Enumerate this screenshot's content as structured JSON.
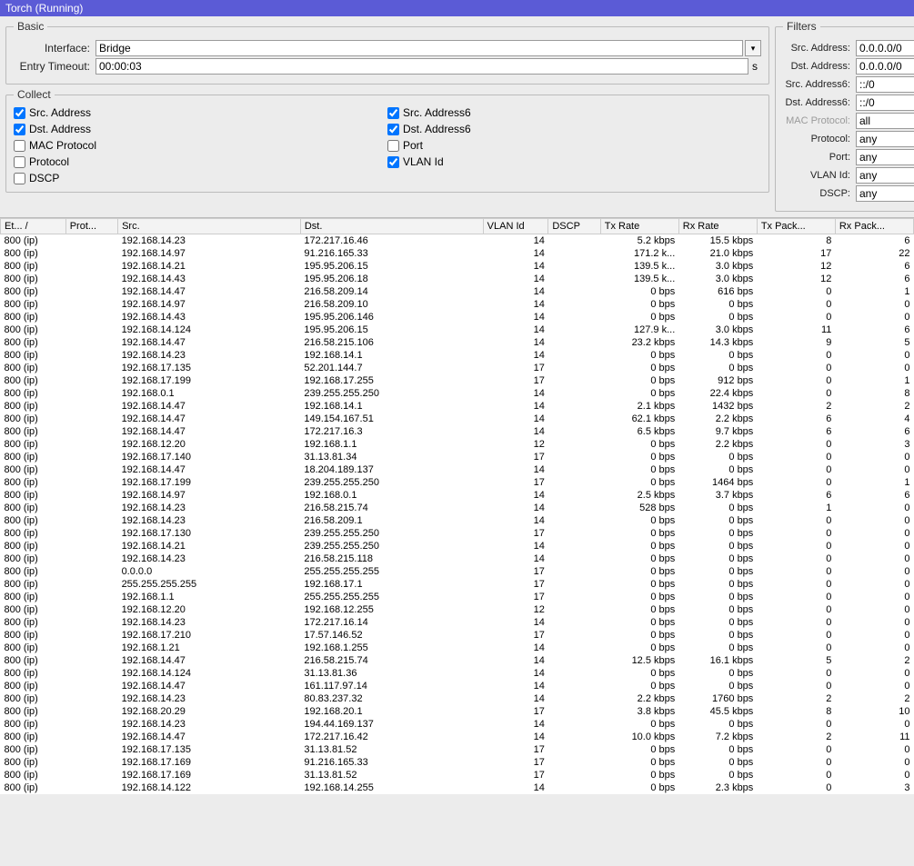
{
  "title": "Torch (Running)",
  "basic": {
    "legend": "Basic",
    "interface_label": "Interface:",
    "interface_value": "Bridge",
    "timeout_label": "Entry Timeout:",
    "timeout_value": "00:00:03",
    "timeout_unit": "s",
    "dropdown_glyph": "▾"
  },
  "collect": {
    "legend": "Collect",
    "left": [
      {
        "label": "Src. Address",
        "checked": true
      },
      {
        "label": "Dst. Address",
        "checked": true
      },
      {
        "label": "MAC Protocol",
        "checked": false
      },
      {
        "label": "Protocol",
        "checked": false
      },
      {
        "label": "DSCP",
        "checked": false
      }
    ],
    "right": [
      {
        "label": "Src. Address6",
        "checked": true
      },
      {
        "label": "Dst. Address6",
        "checked": true
      },
      {
        "label": "Port",
        "checked": false
      },
      {
        "label": "VLAN Id",
        "checked": true
      }
    ]
  },
  "filters": {
    "legend": "Filters",
    "rows": [
      {
        "label": "Src. Address:",
        "value": "0.0.0.0/0"
      },
      {
        "label": "Dst. Address:",
        "value": "0.0.0.0/0"
      },
      {
        "label": "Src. Address6:",
        "value": "::/0"
      },
      {
        "label": "Dst. Address6:",
        "value": "::/0"
      },
      {
        "label": "MAC Protocol:",
        "value": "all",
        "disabled": true
      },
      {
        "label": "Protocol:",
        "value": "any"
      },
      {
        "label": "Port:",
        "value": "any"
      },
      {
        "label": "VLAN Id:",
        "value": "any"
      },
      {
        "label": "DSCP:",
        "value": "any"
      }
    ]
  },
  "columns": [
    "Et... /",
    "Prot...",
    "Src.",
    "Dst.",
    "VLAN Id",
    "DSCP",
    "Tx Rate",
    "Rx Rate",
    "Tx Pack...",
    "Rx Pack..."
  ],
  "rows": [
    [
      "800 (ip)",
      "",
      "192.168.14.23",
      "172.217.16.46",
      "14",
      "",
      "5.2 kbps",
      "15.5 kbps",
      "8",
      "6"
    ],
    [
      "800 (ip)",
      "",
      "192.168.14.97",
      "91.216.165.33",
      "14",
      "",
      "171.2 k...",
      "21.0 kbps",
      "17",
      "22"
    ],
    [
      "800 (ip)",
      "",
      "192.168.14.21",
      "195.95.206.15",
      "14",
      "",
      "139.5 k...",
      "3.0 kbps",
      "12",
      "6"
    ],
    [
      "800 (ip)",
      "",
      "192.168.14.43",
      "195.95.206.18",
      "14",
      "",
      "139.5 k...",
      "3.0 kbps",
      "12",
      "6"
    ],
    [
      "800 (ip)",
      "",
      "192.168.14.47",
      "216.58.209.14",
      "14",
      "",
      "0 bps",
      "616 bps",
      "0",
      "1"
    ],
    [
      "800 (ip)",
      "",
      "192.168.14.97",
      "216.58.209.10",
      "14",
      "",
      "0 bps",
      "0 bps",
      "0",
      "0"
    ],
    [
      "800 (ip)",
      "",
      "192.168.14.43",
      "195.95.206.146",
      "14",
      "",
      "0 bps",
      "0 bps",
      "0",
      "0"
    ],
    [
      "800 (ip)",
      "",
      "192.168.14.124",
      "195.95.206.15",
      "14",
      "",
      "127.9 k...",
      "3.0 kbps",
      "11",
      "6"
    ],
    [
      "800 (ip)",
      "",
      "192.168.14.47",
      "216.58.215.106",
      "14",
      "",
      "23.2 kbps",
      "14.3 kbps",
      "9",
      "5"
    ],
    [
      "800 (ip)",
      "",
      "192.168.14.23",
      "192.168.14.1",
      "14",
      "",
      "0 bps",
      "0 bps",
      "0",
      "0"
    ],
    [
      "800 (ip)",
      "",
      "192.168.17.135",
      "52.201.144.7",
      "17",
      "",
      "0 bps",
      "0 bps",
      "0",
      "0"
    ],
    [
      "800 (ip)",
      "",
      "192.168.17.199",
      "192.168.17.255",
      "17",
      "",
      "0 bps",
      "912 bps",
      "0",
      "1"
    ],
    [
      "800 (ip)",
      "",
      "192.168.0.1",
      "239.255.255.250",
      "14",
      "",
      "0 bps",
      "22.4 kbps",
      "0",
      "8"
    ],
    [
      "800 (ip)",
      "",
      "192.168.14.47",
      "192.168.14.1",
      "14",
      "",
      "2.1 kbps",
      "1432 bps",
      "2",
      "2"
    ],
    [
      "800 (ip)",
      "",
      "192.168.14.47",
      "149.154.167.51",
      "14",
      "",
      "62.1 kbps",
      "2.2 kbps",
      "6",
      "4"
    ],
    [
      "800 (ip)",
      "",
      "192.168.14.47",
      "172.217.16.3",
      "14",
      "",
      "6.5 kbps",
      "9.7 kbps",
      "6",
      "6"
    ],
    [
      "800 (ip)",
      "",
      "192.168.12.20",
      "192.168.1.1",
      "12",
      "",
      "0 bps",
      "2.2 kbps",
      "0",
      "3"
    ],
    [
      "800 (ip)",
      "",
      "192.168.17.140",
      "31.13.81.34",
      "17",
      "",
      "0 bps",
      "0 bps",
      "0",
      "0"
    ],
    [
      "800 (ip)",
      "",
      "192.168.14.47",
      "18.204.189.137",
      "14",
      "",
      "0 bps",
      "0 bps",
      "0",
      "0"
    ],
    [
      "800 (ip)",
      "",
      "192.168.17.199",
      "239.255.255.250",
      "17",
      "",
      "0 bps",
      "1464 bps",
      "0",
      "1"
    ],
    [
      "800 (ip)",
      "",
      "192.168.14.97",
      "192.168.0.1",
      "14",
      "",
      "2.5 kbps",
      "3.7 kbps",
      "6",
      "6"
    ],
    [
      "800 (ip)",
      "",
      "192.168.14.23",
      "216.58.215.74",
      "14",
      "",
      "528 bps",
      "0 bps",
      "1",
      "0"
    ],
    [
      "800 (ip)",
      "",
      "192.168.14.23",
      "216.58.209.1",
      "14",
      "",
      "0 bps",
      "0 bps",
      "0",
      "0"
    ],
    [
      "800 (ip)",
      "",
      "192.168.17.130",
      "239.255.255.250",
      "17",
      "",
      "0 bps",
      "0 bps",
      "0",
      "0"
    ],
    [
      "800 (ip)",
      "",
      "192.168.14.21",
      "239.255.255.250",
      "14",
      "",
      "0 bps",
      "0 bps",
      "0",
      "0"
    ],
    [
      "800 (ip)",
      "",
      "192.168.14.23",
      "216.58.215.118",
      "14",
      "",
      "0 bps",
      "0 bps",
      "0",
      "0"
    ],
    [
      "800 (ip)",
      "",
      "0.0.0.0",
      "255.255.255.255",
      "17",
      "",
      "0 bps",
      "0 bps",
      "0",
      "0"
    ],
    [
      "800 (ip)",
      "",
      "255.255.255.255",
      "192.168.17.1",
      "17",
      "",
      "0 bps",
      "0 bps",
      "0",
      "0"
    ],
    [
      "800 (ip)",
      "",
      "192.168.1.1",
      "255.255.255.255",
      "17",
      "",
      "0 bps",
      "0 bps",
      "0",
      "0"
    ],
    [
      "800 (ip)",
      "",
      "192.168.12.20",
      "192.168.12.255",
      "12",
      "",
      "0 bps",
      "0 bps",
      "0",
      "0"
    ],
    [
      "800 (ip)",
      "",
      "192.168.14.23",
      "172.217.16.14",
      "14",
      "",
      "0 bps",
      "0 bps",
      "0",
      "0"
    ],
    [
      "800 (ip)",
      "",
      "192.168.17.210",
      "17.57.146.52",
      "17",
      "",
      "0 bps",
      "0 bps",
      "0",
      "0"
    ],
    [
      "800 (ip)",
      "",
      "192.168.1.21",
      "192.168.1.255",
      "14",
      "",
      "0 bps",
      "0 bps",
      "0",
      "0"
    ],
    [
      "800 (ip)",
      "",
      "192.168.14.47",
      "216.58.215.74",
      "14",
      "",
      "12.5 kbps",
      "16.1 kbps",
      "5",
      "2"
    ],
    [
      "800 (ip)",
      "",
      "192.168.14.124",
      "31.13.81.36",
      "14",
      "",
      "0 bps",
      "0 bps",
      "0",
      "0"
    ],
    [
      "800 (ip)",
      "",
      "192.168.14.47",
      "161.117.97.14",
      "14",
      "",
      "0 bps",
      "0 bps",
      "0",
      "0"
    ],
    [
      "800 (ip)",
      "",
      "192.168.14.23",
      "80.83.237.32",
      "14",
      "",
      "2.2 kbps",
      "1760 bps",
      "2",
      "2"
    ],
    [
      "800 (ip)",
      "",
      "192.168.20.29",
      "192.168.20.1",
      "17",
      "",
      "3.8 kbps",
      "45.5 kbps",
      "8",
      "10"
    ],
    [
      "800 (ip)",
      "",
      "192.168.14.23",
      "194.44.169.137",
      "14",
      "",
      "0 bps",
      "0 bps",
      "0",
      "0"
    ],
    [
      "800 (ip)",
      "",
      "192.168.14.47",
      "172.217.16.42",
      "14",
      "",
      "10.0 kbps",
      "7.2 kbps",
      "2",
      "11"
    ],
    [
      "800 (ip)",
      "",
      "192.168.17.135",
      "31.13.81.52",
      "17",
      "",
      "0 bps",
      "0 bps",
      "0",
      "0"
    ],
    [
      "800 (ip)",
      "",
      "192.168.17.169",
      "91.216.165.33",
      "17",
      "",
      "0 bps",
      "0 bps",
      "0",
      "0"
    ],
    [
      "800 (ip)",
      "",
      "192.168.17.169",
      "31.13.81.52",
      "17",
      "",
      "0 bps",
      "0 bps",
      "0",
      "0"
    ],
    [
      "800 (ip)",
      "",
      "192.168.14.122",
      "192.168.14.255",
      "14",
      "",
      "0 bps",
      "2.3 kbps",
      "0",
      "3"
    ]
  ]
}
